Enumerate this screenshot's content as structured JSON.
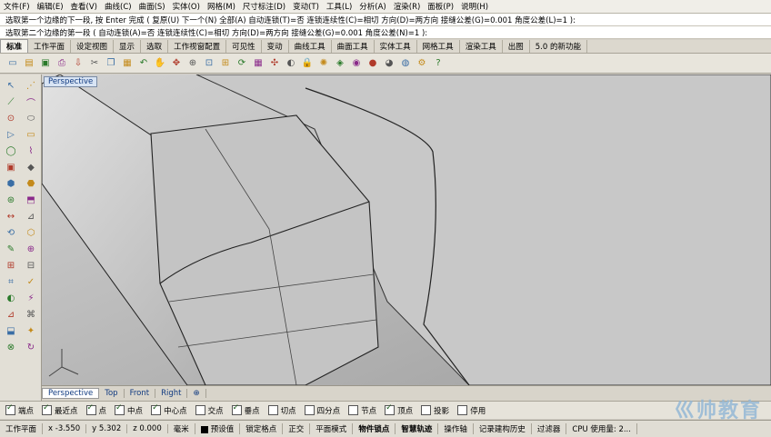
{
  "menu": [
    "文件(F)",
    "编辑(E)",
    "查看(V)",
    "曲线(C)",
    "曲面(S)",
    "实体(O)",
    "网格(M)",
    "尺寸标注(D)",
    "变动(T)",
    "工具(L)",
    "分析(A)",
    "渲染(R)",
    "面板(P)",
    "说明(H)"
  ],
  "command_line_1": "选取第一个边缘的下一段, 按 Enter 完成 ( 复原(U) 下一个(N) 全部(A) 自动连锁(T)=否 连锁连续性(C)=相切 方向(D)=两方向 接缝公差(G)=0.001 角度公差(L)=1 ):",
  "command_line_2": "选取第二个边缘的第一段 ( 自动连锁(A)=否 连锁连续性(C)=相切 方向(D)=两方向 接缝公差(G)=0.001 角度公差(N)=1 ):",
  "toolbar_tabs": [
    "标准",
    "工作平面",
    "设定视图",
    "显示",
    "选取",
    "工作视窗配置",
    "可见性",
    "变动",
    "曲线工具",
    "曲面工具",
    "实体工具",
    "网格工具",
    "渲染工具",
    "出图",
    "5.0 的新功能"
  ],
  "active_toolbar_tab": "标准",
  "toolbar_icons": [
    "new-icon",
    "open-icon",
    "save-icon",
    "print-icon",
    "import-icon",
    "cut-icon",
    "copy-icon",
    "paste-icon",
    "undo-icon",
    "pan-icon",
    "move-icon",
    "zoom-icon",
    "zoom-window-icon",
    "zoom-extents-icon",
    "rotate-view-icon",
    "grid-icon",
    "snap-icon",
    "hide-icon",
    "lock-icon",
    "light-icon",
    "layer-icon",
    "material-icon",
    "render-icon",
    "sphere-icon",
    "globe-icon",
    "options-icon",
    "help-icon"
  ],
  "viewport": {
    "label": "Perspective"
  },
  "viewport_tabs": [
    "Perspective",
    "Top",
    "Front",
    "Right"
  ],
  "active_viewport_tab": "Perspective",
  "osnaps": [
    {
      "label": "端点",
      "on": true
    },
    {
      "label": "最近点",
      "on": true
    },
    {
      "label": "点",
      "on": true
    },
    {
      "label": "中点",
      "on": true
    },
    {
      "label": "中心点",
      "on": true
    },
    {
      "label": "交点",
      "on": false
    },
    {
      "label": "垂点",
      "on": true
    },
    {
      "label": "切点",
      "on": false
    },
    {
      "label": "四分点",
      "on": false
    },
    {
      "label": "节点",
      "on": false
    },
    {
      "label": "顶点",
      "on": true
    },
    {
      "label": "投影",
      "on": false
    },
    {
      "label": "停用",
      "on": false
    }
  ],
  "status": {
    "cplane": "工作平面",
    "x": "x -3.550",
    "y": "y 5.302",
    "z": "z 0.000",
    "unit": "毫米",
    "layer": "预设值",
    "items": [
      "锁定格点",
      "正交",
      "平面模式",
      "物件锁点",
      "智慧轨迹",
      "操作轴",
      "记录建构历史",
      "过滤器",
      "CPU 使用量: 2..."
    ]
  },
  "watermark": "巛帅教育"
}
